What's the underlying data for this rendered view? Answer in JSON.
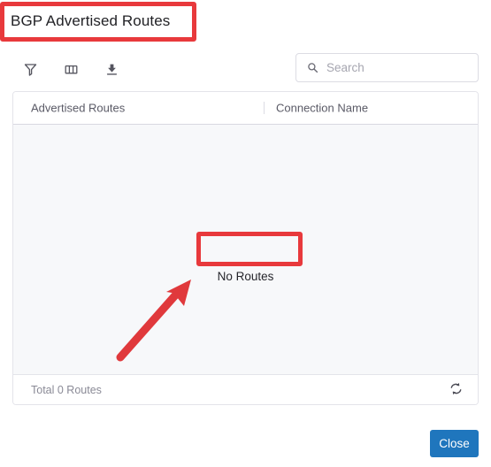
{
  "dialog": {
    "title": "BGP Advertised Routes"
  },
  "toolbar": {
    "filter_icon": "filter-icon",
    "columns_icon": "columns-icon",
    "download_icon": "download-icon",
    "search": {
      "icon": "search-icon",
      "placeholder": "Search",
      "value": ""
    }
  },
  "table": {
    "columns": [
      {
        "label": "Advertised Routes"
      },
      {
        "label": "Connection Name"
      }
    ],
    "rows": [],
    "empty_message": "No Routes",
    "footer": {
      "total_label": "Total 0 Routes",
      "refresh_icon": "refresh-icon"
    }
  },
  "actions": {
    "close_label": "Close"
  },
  "annotations": {
    "highlight_color": "#e8393c",
    "arrow_color": "#e0393c",
    "boxes": [
      {
        "target": "page-title"
      },
      {
        "target": "empty-state-text"
      }
    ],
    "arrow": {
      "points_to": "empty-state-text"
    }
  },
  "colors": {
    "accent_blue": "#1f76bd",
    "annotation_red": "#e8393c",
    "table_body_bg": "#f7f8fa",
    "border_gray": "#e4e4ea"
  }
}
